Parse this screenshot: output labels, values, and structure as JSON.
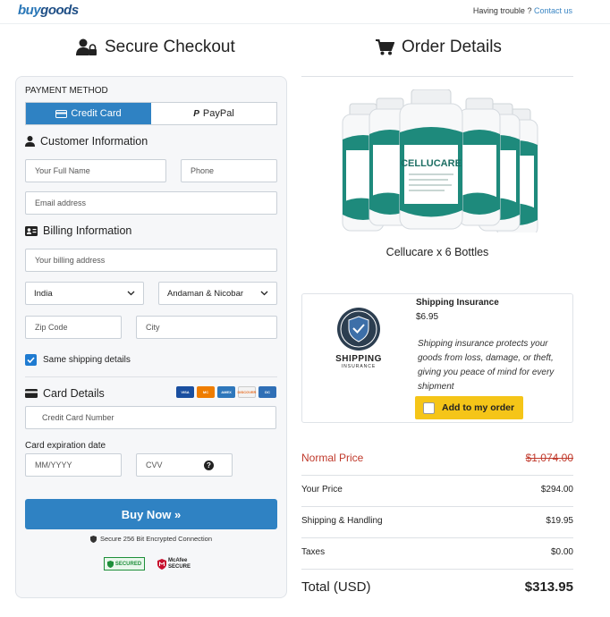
{
  "header": {
    "logo_a": "buy",
    "logo_b": "goods",
    "trouble_text": "Having trouble ?",
    "contact_link": "Contact us"
  },
  "checkout": {
    "title": "Secure Checkout",
    "payment_method_label": "PAYMENT METHOD",
    "tab_credit": "Credit Card",
    "tab_paypal": "PayPal",
    "customer_info_title": "Customer Information",
    "full_name_placeholder": "Your Full Name",
    "phone_placeholder": "Phone",
    "email_placeholder": "Email address",
    "billing_info_title": "Billing Information",
    "billing_address_placeholder": "Your billing address",
    "country_value": "India",
    "state_value": "Andaman & Nicobar",
    "zip_placeholder": "Zip Code",
    "city_placeholder": "City",
    "same_shipping_label": "Same shipping details",
    "same_shipping_checked": true,
    "card_details_title": "Card Details",
    "card_logos": [
      "VISA",
      "MC",
      "AMEX",
      "DISCOVER",
      "DC"
    ],
    "card_number_placeholder": "Credit Card Number",
    "expiration_label": "Card expiration date",
    "expiry_placeholder": "MM/YYYY",
    "cvv_placeholder": "CVV",
    "buy_button": "Buy Now »",
    "secure_note": "Secure 256 Bit Encrypted Connection",
    "badge_secured": "SECURED",
    "badge_mcafee": "McAfee SECURE"
  },
  "order": {
    "title": "Order Details",
    "product_label": "CELLUCARE",
    "product_name": "Cellucare x 6 Bottles",
    "insurance": {
      "title": "Shipping Insurance",
      "price": "$6.95",
      "description": "Shipping insurance protects your goods from loss, damage, or theft, giving you peace of mind for every shipment",
      "badge_text": "SHIPPING",
      "badge_sub": "INSURANCE",
      "add_button": "Add to my order"
    },
    "normal_price_label": "Normal Price",
    "normal_price_value": "$1,074.00",
    "your_price_label": "Your Price",
    "your_price_value": "$294.00",
    "shipping_label": "Shipping & Handling",
    "shipping_value": "$19.95",
    "taxes_label": "Taxes",
    "taxes_value": "$0.00",
    "total_label": "Total (USD)",
    "total_value": "$313.95"
  },
  "colors": {
    "accent_blue": "#2f82c3",
    "normal_price_red": "#c0392b",
    "add_button_yellow": "#f5c518"
  }
}
